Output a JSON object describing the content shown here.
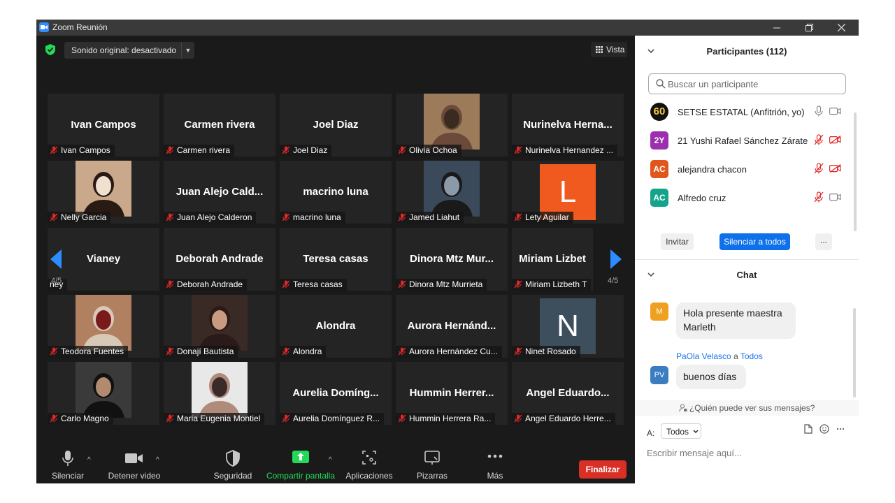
{
  "window": {
    "title": "Zoom Reunión"
  },
  "top": {
    "sound_label": "Sonido original: desactivado",
    "view_label": "Vista"
  },
  "gallery": {
    "page_left": "4/5",
    "page_right": "4/5",
    "tiles": [
      {
        "big": "Ivan Campos",
        "name": "Ivan Campos"
      },
      {
        "big": "Carmen rivera",
        "name": "Carmen rivera"
      },
      {
        "big": "Joel Diaz",
        "name": "Joel Diaz"
      },
      {
        "big": "",
        "name": "Olivia Ochoa"
      },
      {
        "big": "Nurinelva  Herna...",
        "name": "Nurinelva Hernandez ..."
      },
      {
        "big": "",
        "name": "Nelly Garcia"
      },
      {
        "big": "Juan Alejo Cald...",
        "name": "Juan Alejo Calderon"
      },
      {
        "big": "macrino luna",
        "name": "macrino luna"
      },
      {
        "big": "",
        "name": "Jamed Liahut"
      },
      {
        "big": "L",
        "name": "Lety Aguilar"
      },
      {
        "big": "Vianey",
        "name": "ney"
      },
      {
        "big": "Deborah Andrade",
        "name": "Deborah Andrade"
      },
      {
        "big": "Teresa  casas",
        "name": "Teresa  casas"
      },
      {
        "big": "Dinora  Mtz  Mur...",
        "name": "Dinora Mtz Murrieta"
      },
      {
        "big": "Miriam  Lizbet",
        "name": "Miriam Lizbeth T"
      },
      {
        "big": "",
        "name": "Teodora Fuentes"
      },
      {
        "big": "",
        "name": "Donají Bautista"
      },
      {
        "big": "Alondra",
        "name": "Alondra"
      },
      {
        "big": "Aurora  Hernánd...",
        "name": "Aurora Hernández Cu..."
      },
      {
        "big": "N",
        "name": "Ninet Rosado"
      },
      {
        "big": "",
        "name": "Carlo Magno"
      },
      {
        "big": "",
        "name": "Maria Eugenia Montiel"
      },
      {
        "big": "Aurelia  Domíng...",
        "name": "Aurelia Domínguez R..."
      },
      {
        "big": "Hummin  Herrer...",
        "name": "Hummin Herrera Ra..."
      },
      {
        "big": "Angel  Eduardo...",
        "name": "Angel Eduardo Herre..."
      }
    ]
  },
  "toolbar": {
    "mute": "Silenciar",
    "video": "Detener video",
    "security": "Seguridad",
    "share": "Compartir pantalla",
    "apps": "Aplicaciones",
    "whiteboards": "Pizarras",
    "more": "Más",
    "end": "Finalizar"
  },
  "participants": {
    "title": "Participantes (112)",
    "search_placeholder": "Buscar un participante",
    "list": [
      {
        "initials": "60",
        "name": "SETSE ESTATAL (Anfitrión, yo)",
        "color": "#111111"
      },
      {
        "initials": "2Y",
        "name": "21 Yushi Rafael Sánchez Zárate",
        "color": "#9b2fae"
      },
      {
        "initials": "AC",
        "name": "alejandra chacon",
        "color": "#e0561b"
      },
      {
        "initials": "AC",
        "name": "Alfredo cruz",
        "color": "#14a38b"
      }
    ],
    "invite": "Invitar",
    "mute_all": "Silenciar a todos",
    "more": "..."
  },
  "chat": {
    "title": "Chat",
    "messages": [
      {
        "initials": "M",
        "text_line1": "Hola presente maestra",
        "text_line2": "Marleth",
        "color": "#f0a020"
      },
      {
        "sender": "PaOla Velasco",
        "connector": "a",
        "recipient": "Todos",
        "initials": "PV",
        "text": "buenos días",
        "color": "#3b7dbf"
      }
    ],
    "who_can_see": "¿Quién puede ver sus mensajes?",
    "to_label": "A:",
    "to_value": "Todos",
    "input_placeholder": "Escribir mensaje aquí..."
  }
}
